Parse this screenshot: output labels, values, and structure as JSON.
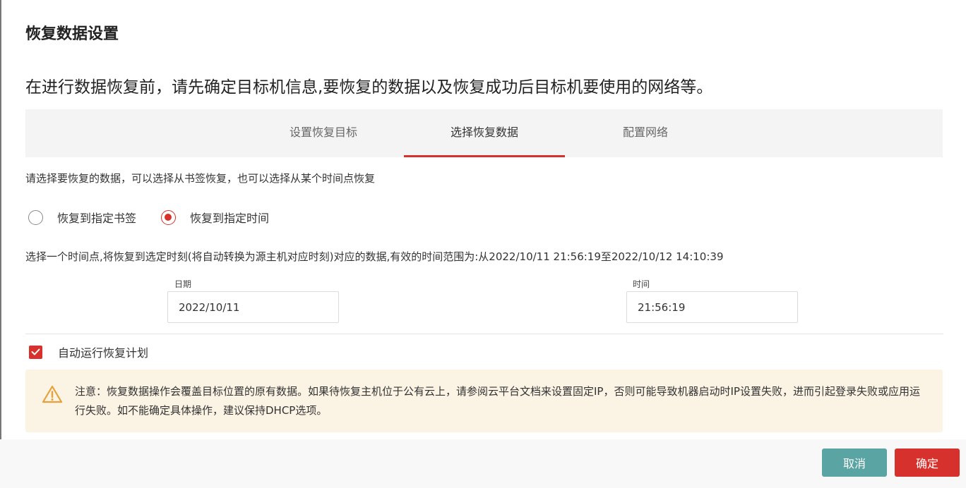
{
  "dialog": {
    "title": "恢复数据设置",
    "intro": "在进行数据恢复前，请先确定目标机信息,要恢复的数据以及恢复成功后目标机要使用的网络等。"
  },
  "tabs": [
    {
      "label": "设置恢复目标",
      "active": false
    },
    {
      "label": "选择恢复数据",
      "active": true
    },
    {
      "label": "配置网络",
      "active": false
    }
  ],
  "restore": {
    "hint": "请选择要恢复的数据，可以选择从书签恢复，也可以选择从某个时间点恢复",
    "options": [
      {
        "label": "恢复到指定书签",
        "checked": false
      },
      {
        "label": "恢复到指定时间",
        "checked": true
      }
    ],
    "range_text": "选择一个时间点,将恢复到选定时刻(将自动转换为源主机对应时刻)对应的数据,有效的时间范围为:从2022/10/11 21:56:19至2022/10/12 14:10:39",
    "date_label": "日期",
    "date_value": "2022/10/11",
    "time_label": "时间",
    "time_value": "21:56:19",
    "auto_run_label": "自动运行恢复计划",
    "auto_run_checked": true
  },
  "notice": {
    "icon": "warning-icon",
    "text": "注意：恢复数据操作会覆盖目标位置的原有数据。如果待恢复主机位于公有云上，请参阅云平台文档来设置固定IP，否则可能导致机器启动时IP设置失败，进而引起登录失败或应用运行失败。如不能确定具体操作，建议保持DHCP选项。"
  },
  "footer": {
    "cancel_label": "取消",
    "ok_label": "确定"
  },
  "colors": {
    "accent": "#d6312c",
    "cancel": "#5aa4a3",
    "warning": "#e8a13a",
    "notice_bg": "#fbf3e4"
  }
}
